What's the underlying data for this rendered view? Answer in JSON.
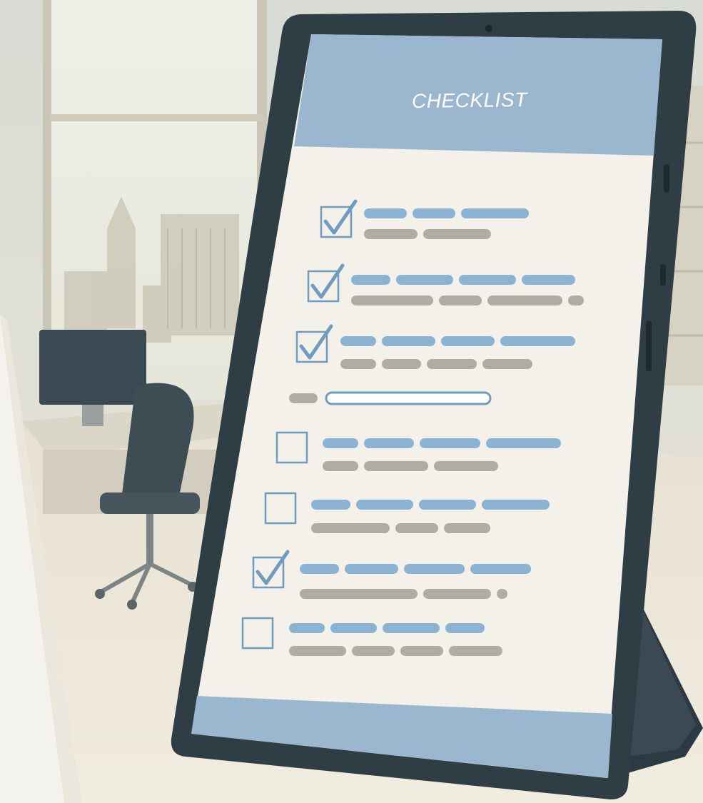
{
  "screen": {
    "title": "CHECKLIST"
  },
  "checklist": {
    "items": [
      {
        "checked": true,
        "lines": [
          3,
          2
        ]
      },
      {
        "checked": true,
        "lines": [
          4,
          4
        ]
      },
      {
        "checked": true,
        "lines": [
          4,
          4
        ]
      },
      {
        "checked": false,
        "lines": [
          1,
          1
        ]
      },
      {
        "checked": false,
        "lines": [
          4,
          3
        ]
      },
      {
        "checked": false,
        "lines": [
          4,
          3
        ]
      },
      {
        "checked": true,
        "lines": [
          4,
          3
        ]
      },
      {
        "checked": false,
        "lines": [
          4,
          4
        ]
      }
    ]
  },
  "colors": {
    "screen_header": "#9bb7cf",
    "screen_body": "#f3f1ea",
    "check_blue": "#6f9cbf",
    "text_blue": "#8db3d2",
    "text_gray": "#b1aca3",
    "device_frame": "#2f3d45",
    "stand": "#2c3a43"
  },
  "icons": {
    "checked_box": "checkbox-checked-icon",
    "empty_box": "checkbox-empty-icon"
  }
}
